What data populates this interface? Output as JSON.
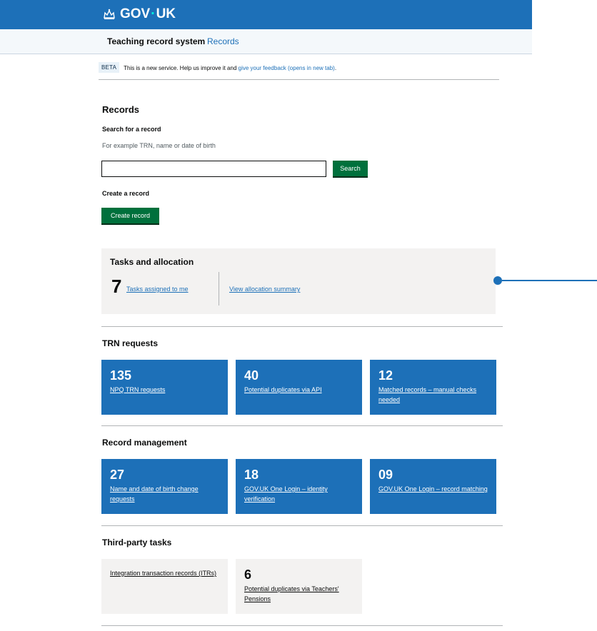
{
  "header": {
    "logo_text_a": "GOV",
    "logo_dot": "·",
    "logo_text_b": "UK",
    "logo_icon": "crown-icon"
  },
  "nav": {
    "service_name": "Teaching record system",
    "link": "Records"
  },
  "phase_banner": {
    "tag": "BETA",
    "text": "This is a new service. Help us improve it and ",
    "link": "give your feedback (opens in new tab)",
    "suffix": "."
  },
  "records": {
    "heading": "Records",
    "search_label": "Search for a record",
    "search_hint": "For example TRN, name or date of birth",
    "search_value": "",
    "search_button": "Search",
    "create_heading": "Create a record",
    "create_button": "Create record"
  },
  "tasks": {
    "title": "Tasks and allocation",
    "count": "7",
    "assigned_link": "Tasks assigned to me",
    "allocation_link": "View allocation summary"
  },
  "trn_requests": {
    "title": "TRN requests",
    "cards": [
      {
        "count": "135",
        "label": "NPQ TRN requests"
      },
      {
        "count": "40",
        "label": "Potential duplicates via API"
      },
      {
        "count": "12",
        "label": "Matched records – manual checks needed"
      }
    ]
  },
  "record_management": {
    "title": "Record management",
    "cards": [
      {
        "count": "27",
        "label": "Name and date of birth change requests"
      },
      {
        "count": "18",
        "label": "GOV.UK One Login – identity verification"
      },
      {
        "count": "09",
        "label": "GOV.UK One Login – record matching"
      }
    ]
  },
  "third_party": {
    "title": "Third-party tasks",
    "cards": [
      {
        "label": "Integration transaction records (ITRs)"
      },
      {
        "count": "6",
        "label": "Potential duplicates via Teachers' Pensions"
      }
    ]
  },
  "colors": {
    "brand": "#1d70b8",
    "button": "#00703c",
    "panel": "#f3f2f1"
  }
}
